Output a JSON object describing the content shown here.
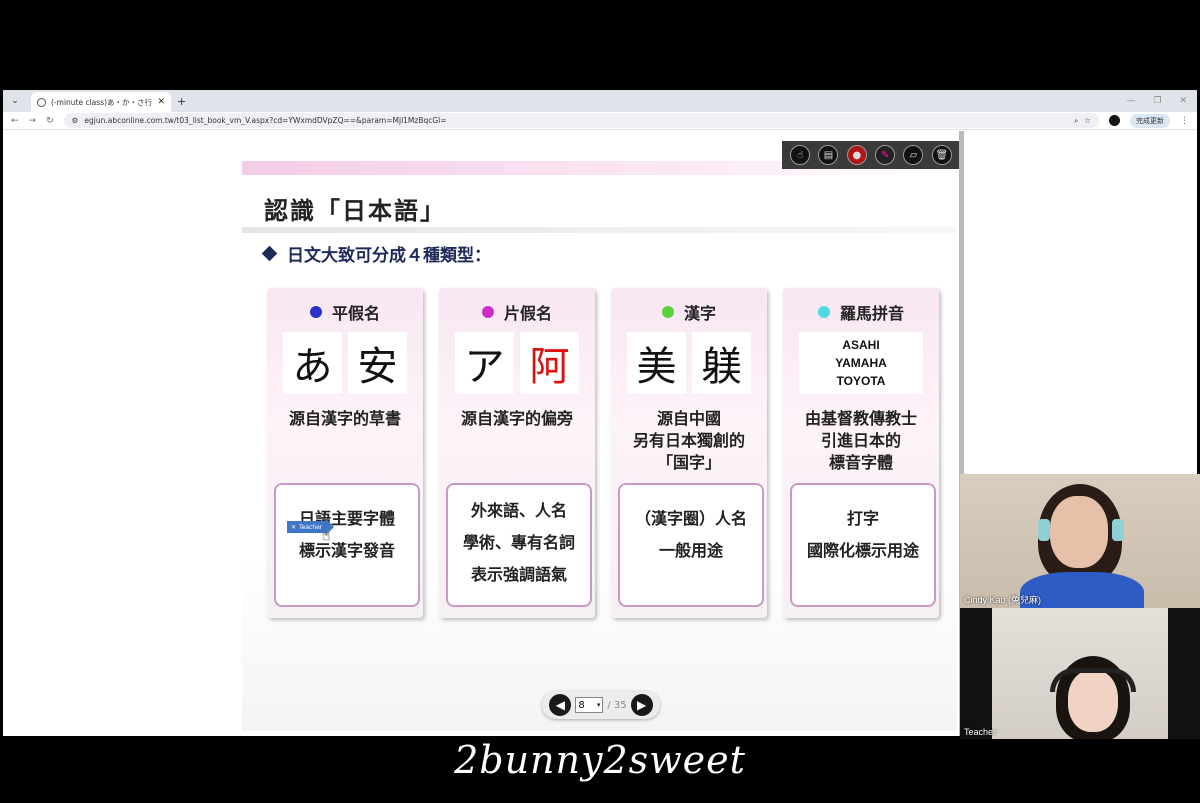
{
  "browser": {
    "tab_title": "(-minute class)あ・か・さ行",
    "tab_close": "✕",
    "new_tab": "+",
    "url": "egjun.abconline.com.tw/t03_list_book_vm_V.aspx?cd=YWxmdDVpZQ==&param=Mjl1MzBqcGl=",
    "update_label": "完成更新"
  },
  "toolbar": {
    "tools": [
      "pointer",
      "notepad",
      "record",
      "pen",
      "eraser",
      "trash"
    ]
  },
  "slide": {
    "title": "認識「日本語」",
    "subtitle": "日文大致可分成４種類型：",
    "cards": [
      {
        "heading": "平假名",
        "dot_color": "#2a32c8",
        "glyphs": [
          "あ",
          "安"
        ],
        "origin": [
          "源自漢字的草書"
        ],
        "usage": [
          "日語主要字體",
          "標示漢字發音"
        ]
      },
      {
        "heading": "片假名",
        "dot_color": "#cc2fc4",
        "glyphs": [
          "ア",
          "阿"
        ],
        "origin": [
          "源自漢字的偏旁"
        ],
        "usage": [
          "外來語、人名",
          "學術、專有名詞",
          "表示強調語氣"
        ]
      },
      {
        "heading": "漢字",
        "dot_color": "#5bd23b",
        "glyphs": [
          "美",
          "躾"
        ],
        "origin": [
          "源自中國",
          "另有日本獨創的",
          "「国字」"
        ],
        "usage": [
          "（漢字圈）人名",
          "一般用途"
        ]
      },
      {
        "heading": "羅馬拼音",
        "dot_color": "#4fd8e8",
        "romaji": [
          "ASAHI",
          "YAMAHA",
          "TOYOTA"
        ],
        "origin": [
          "由基督教傳教士",
          "引進日本的",
          "標音字體"
        ],
        "usage": [
          "打字",
          "國際化標示用途"
        ]
      }
    ],
    "teacher_tag": "Teacher"
  },
  "pager": {
    "current": "8",
    "total": "/ 35"
  },
  "video": {
    "participant1": "Cindy Kao (兔兒麻)",
    "participant2": "Teacher"
  },
  "watermark": "2bunny2sweet"
}
